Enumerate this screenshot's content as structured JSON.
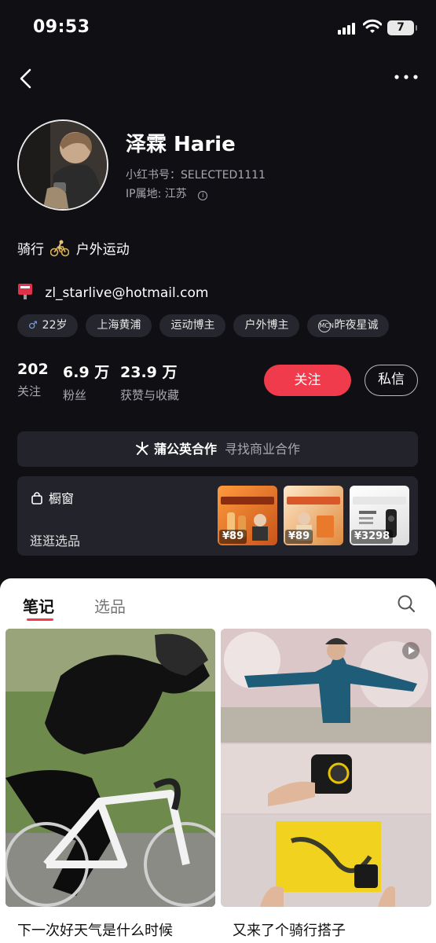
{
  "status_bar": {
    "time": "09:53",
    "battery": "7"
  },
  "profile": {
    "name": "泽霖 Harie",
    "xhs_id": "小红书号：SELECTED1111",
    "ip_location": "IP属地: 江苏",
    "bio_part1": "骑行",
    "bio_part2": "户外运动",
    "email": "zl_starlive@hotmail.com",
    "tags": [
      "22岁",
      "上海黄浦",
      "运动博主",
      "户外博主",
      "昨夜星诚"
    ]
  },
  "stats": [
    {
      "value": "202",
      "label": "关注"
    },
    {
      "value": "6.9 万",
      "label": "粉丝"
    },
    {
      "value": "23.9 万",
      "label": "获赞与收藏"
    }
  ],
  "actions": {
    "follow": "关注",
    "message": "私信"
  },
  "collab": {
    "title": "蒲公英合作",
    "subtitle": "寻找商业合作"
  },
  "shop": {
    "title": "橱窗",
    "subtitle": "逛逛选品",
    "products": [
      {
        "price": "¥89"
      },
      {
        "price": "¥89"
      },
      {
        "price": "¥3298"
      }
    ]
  },
  "tabs": {
    "notes": "笔记",
    "selected": "选品"
  },
  "notes": [
    {
      "title": "下一次好天气是什么时候"
    },
    {
      "title": "又来了个骑行搭子"
    }
  ],
  "colors": {
    "accent": "#ef3b4b",
    "background": "#0f0f14",
    "card": "#23232b"
  },
  "icons": [
    "back-icon",
    "more-icon",
    "info-icon",
    "bike-emoji",
    "mailbox-icon",
    "male-icon",
    "mcn-icon",
    "sparkle-icon",
    "bag-icon",
    "search-icon",
    "play-icon"
  ]
}
